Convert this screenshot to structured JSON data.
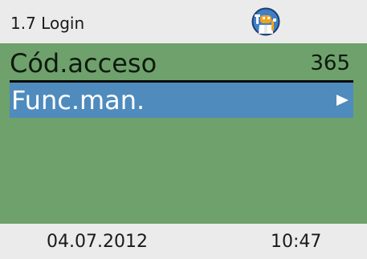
{
  "header": {
    "title": "1.7 Login",
    "status_icon": "technician-icon"
  },
  "menu": {
    "access_code": {
      "label": "Cód.acceso",
      "value": "365"
    },
    "manual_function": {
      "label": "Func.man.",
      "arrow_icon": "arrow-right-icon"
    }
  },
  "footer": {
    "date": "04.07.2012",
    "time": "10:47"
  },
  "colors": {
    "header_bg": "#ebebeb",
    "main_bg": "#6fa16c",
    "selection_bg": "#4f8bbd",
    "icon_circle": "#3f7fc6",
    "icon_face": "#f2a21b"
  }
}
